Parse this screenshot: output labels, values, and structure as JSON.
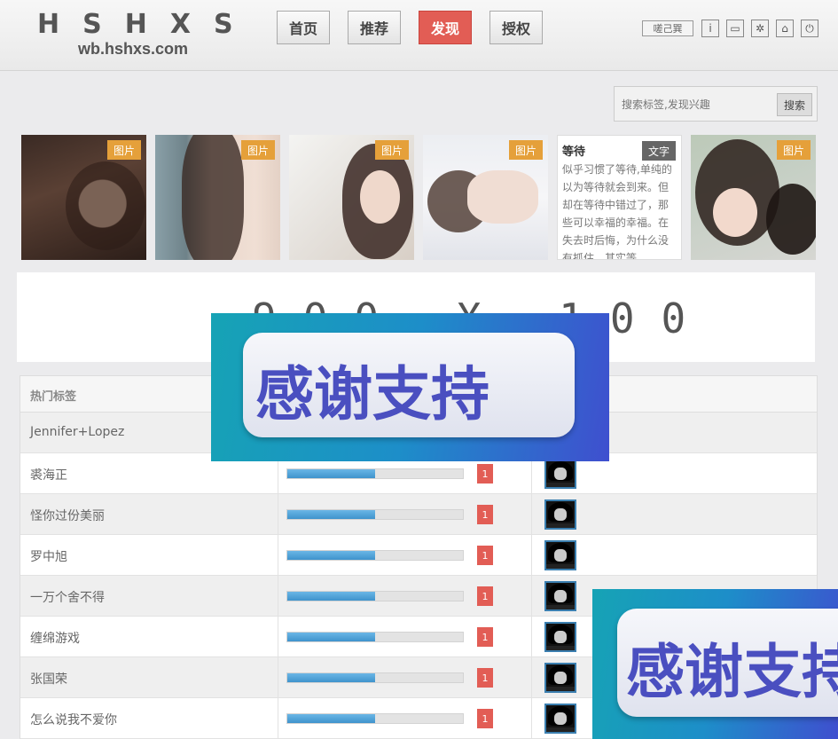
{
  "header": {
    "logo": "HSHXS",
    "logo_sub": "wb.hshxs.com",
    "nav": [
      "首页",
      "推荐",
      "发现",
      "授权"
    ],
    "active_nav": "发现",
    "user": "嗟己巽",
    "icons": [
      "info-icon",
      "message-icon",
      "gear-icon",
      "home-icon",
      "power-icon"
    ],
    "info_glyph": "i",
    "message_glyph": "▭",
    "gear_glyph": "✲",
    "home_glyph": "⌂",
    "power_glyph": "⏻"
  },
  "search": {
    "placeholder": "搜索标签,发现兴趣",
    "button": "搜索"
  },
  "thumbnails": [
    {
      "tag": "图片"
    },
    {
      "tag": "图片"
    },
    {
      "tag": "图片"
    },
    {
      "tag": "图片"
    },
    {
      "tag": "文字",
      "title": "等待",
      "text": " 似乎习惯了等待,单纯的以为等待就会到来。但却在等待中错过了，那些可以幸福的幸福。在失去时后悔，为什么没有抓住。其实等"
    },
    {
      "tag": "图片"
    }
  ],
  "ad": {
    "text": "900 X 100"
  },
  "hot_tags": {
    "title": "热门标签",
    "rows": [
      {
        "name": "Jennifer+Lopez"
      },
      {
        "name": "裘海正",
        "count": "1",
        "level": 0.5
      },
      {
        "name": "怪你过份美丽",
        "count": "1",
        "level": 0.5
      },
      {
        "name": "罗中旭",
        "count": "1",
        "level": 0.5
      },
      {
        "name": "一万个舍不得",
        "count": "1",
        "level": 0.5
      },
      {
        "name": "缠绵游戏",
        "count": "1",
        "level": 0.5
      },
      {
        "name": "张国荣",
        "count": "1",
        "level": 0.5
      },
      {
        "name": "怎么说我不爱你",
        "count": "1",
        "level": 0.5
      }
    ]
  },
  "overlay": {
    "text": "感谢支持",
    "text_partial": "感谢支持"
  },
  "colors": {
    "accent": "#e25d55",
    "badge": "#e5a03a",
    "bar": "#3f93cc"
  }
}
